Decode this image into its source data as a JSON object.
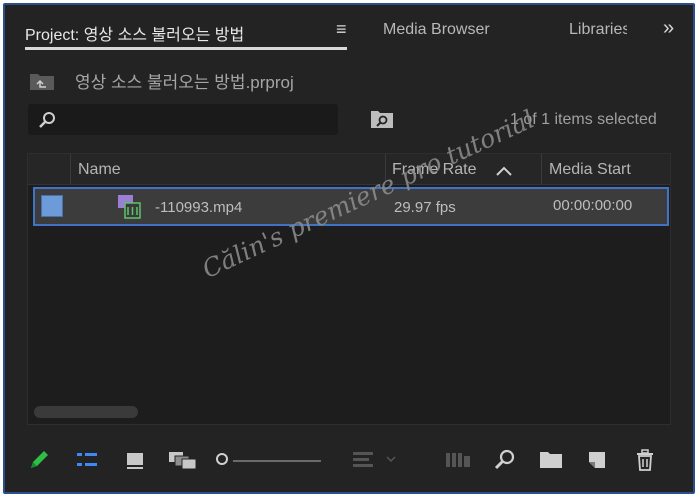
{
  "tabs": {
    "project": "Project: 영상 소스 불러오는 방법",
    "menu": "≡",
    "media_browser": "Media Browser",
    "libraries": "Libraries",
    "more": "»"
  },
  "project_file": "영상 소스 불러오는 방법.prproj",
  "search": {
    "placeholder": ""
  },
  "selection_status": "1 of 1 items selected",
  "columns": {
    "name": "Name",
    "frame_rate": "Frame Rate",
    "media_start": "Media Start"
  },
  "items": [
    {
      "name": "-110993.mp4",
      "frame_rate": "29.97 fps",
      "media_start": "00:00:00:00",
      "label_color": "#6d9ad8"
    }
  ],
  "watermark": "Călin's premiere pro tutorial",
  "colors": {
    "accent": "#3e73c5",
    "pencil": "#2fbf45",
    "list_view": "#3d8af7"
  },
  "toolbar": {
    "icons": [
      "pencil-icon",
      "list-view-icon",
      "icon-view-icon",
      "freeform-view-icon",
      "zoom-slider",
      "sort-icons-icon",
      "automate-to-sequence-icon",
      "find-icon",
      "new-bin-icon",
      "new-item-icon",
      "trash-icon"
    ]
  }
}
